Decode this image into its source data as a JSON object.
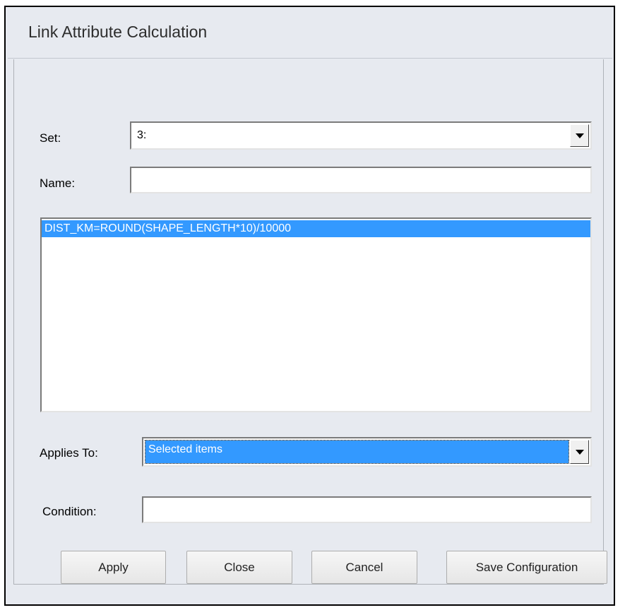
{
  "dialog": {
    "title": "Link Attribute Calculation"
  },
  "form": {
    "set_label": "Set:",
    "set_value": "3:",
    "name_label": "Name:",
    "name_value": "",
    "expressions": [
      "DIST_KM=ROUND(SHAPE_LENGTH*10)/10000"
    ],
    "applies_to_label": "Applies To:",
    "applies_to_value": "Selected items",
    "condition_label": "Condition:",
    "condition_value": ""
  },
  "buttons": {
    "apply": "Apply",
    "close": "Close",
    "cancel": "Cancel",
    "save_configuration": "Save Configuration"
  },
  "colors": {
    "selection": "#3399ff",
    "dialog_bg": "#e7eaf0"
  }
}
